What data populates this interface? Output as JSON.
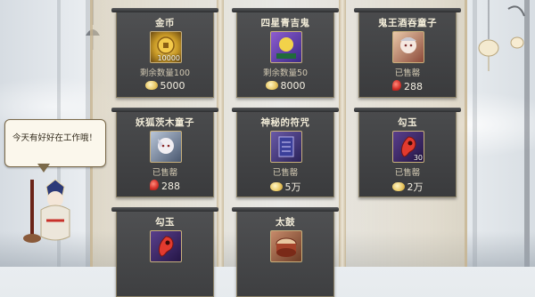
{
  "dialog": {
    "text": "今天有好好在工作哦！"
  },
  "shop": {
    "items": [
      {
        "name": "金币",
        "icon": "gold-coin-icon",
        "icon_count": "10000",
        "sub": "剩余数量100",
        "currency": "coin",
        "price": "5000"
      },
      {
        "name": "四星青吉鬼",
        "icon": "shikigami-portrait-icon",
        "icon_count": "",
        "sub": "剩余数量50",
        "currency": "coin",
        "price": "8000"
      },
      {
        "name": "鬼王酒吞童子",
        "icon": "shuten-doji-skin-icon",
        "icon_count": "",
        "sub": "已售罄",
        "currency": "jade",
        "price": "288"
      },
      {
        "name": "妖狐茨木童子",
        "icon": "ibaraki-skin-icon",
        "icon_count": "",
        "sub": "已售罄",
        "currency": "jade",
        "price": "288"
      },
      {
        "name": "神秘的符咒",
        "icon": "mystery-talisman-icon",
        "icon_count": "",
        "sub": "已售罄",
        "currency": "coin",
        "price": "5万"
      },
      {
        "name": "勾玉",
        "icon": "magatama-icon",
        "icon_count": "30",
        "sub": "已售罄",
        "currency": "coin",
        "price": "2万"
      },
      {
        "name": "勾玉",
        "icon": "magatama-icon",
        "icon_count": "",
        "sub": "",
        "currency": "",
        "price": ""
      },
      {
        "name": "太鼓",
        "icon": "taiko-drum-icon",
        "icon_count": "",
        "sub": "",
        "currency": "",
        "price": ""
      }
    ]
  },
  "colors": {
    "card_bg": "#454648",
    "card_border": "#8b8167",
    "title_text": "#f2ecd8",
    "jade_red": "#d6322b",
    "coin_gold": "#e8c660"
  }
}
